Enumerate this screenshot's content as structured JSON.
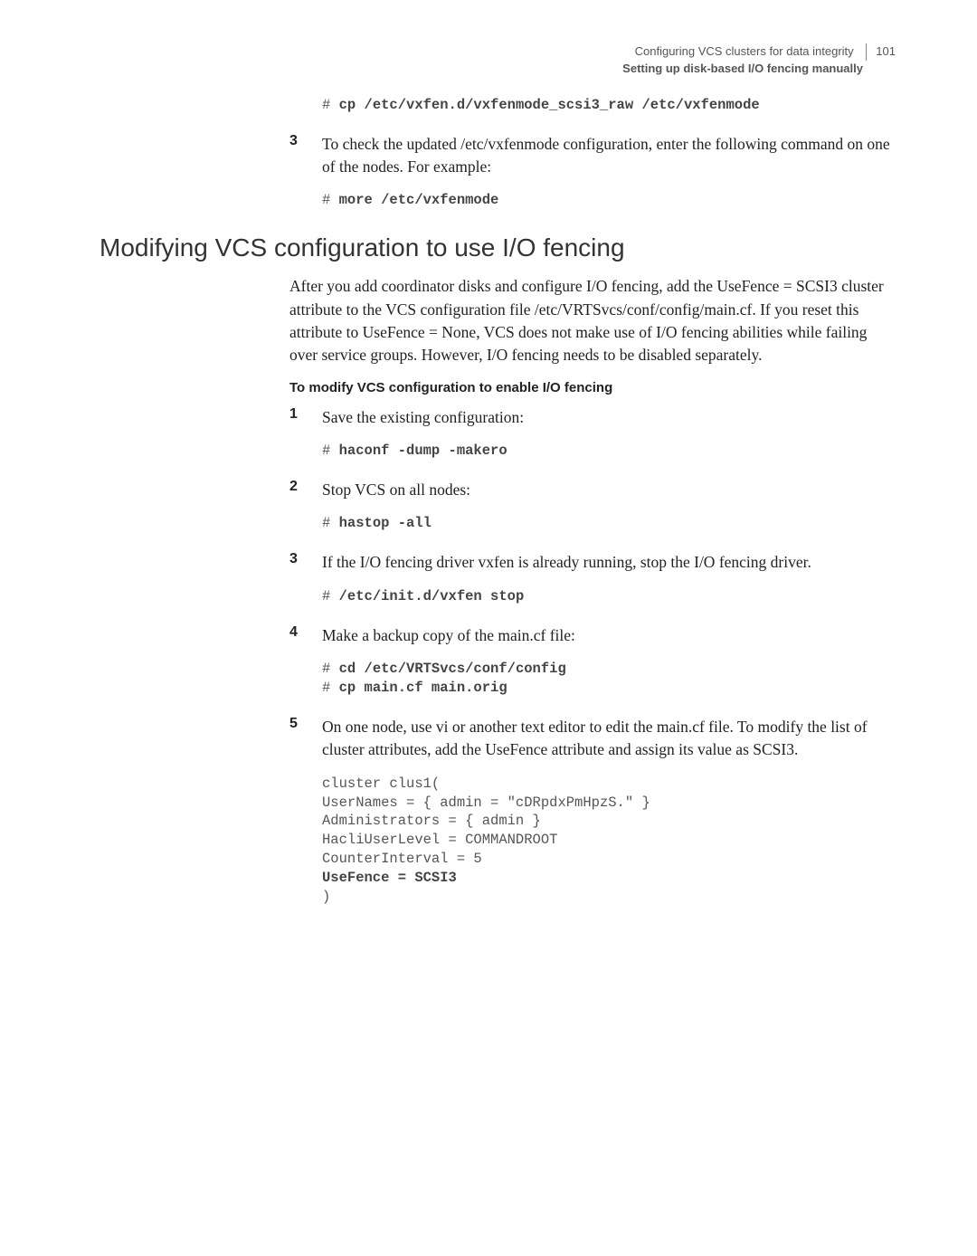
{
  "header": {
    "chapter": "Configuring VCS clusters for data integrity",
    "page": "101",
    "section": "Setting up disk-based I/O fencing manually"
  },
  "intro_code": "# cp /etc/vxfen.d/vxfenmode_scsi3_raw /etc/vxfenmode",
  "intro_step": {
    "num": "3",
    "text": "To check the updated /etc/vxfenmode configuration, enter the following command on one of the nodes. For example:"
  },
  "intro_step_code": "# more /etc/vxfenmode",
  "heading": "Modifying VCS configuration to use I/O fencing",
  "body": "After you add coordinator disks and configure I/O fencing, add the UseFence = SCSI3 cluster attribute to the VCS configuration file /etc/VRTSvcs/conf/config/main.cf. If you reset this attribute to UseFence = None, VCS does not make use of I/O fencing abilities while failing over service groups. However, I/O fencing needs to be disabled separately.",
  "subhead": "To modify VCS configuration to enable I/O fencing",
  "steps": [
    {
      "num": "1",
      "text": "Save the existing configuration:"
    },
    {
      "num": "2",
      "text": "Stop VCS on all nodes:"
    },
    {
      "num": "3",
      "text": "If the I/O fencing driver vxfen is already running, stop the I/O fencing driver."
    },
    {
      "num": "4",
      "text": "Make a backup copy of the main.cf file:"
    },
    {
      "num": "5",
      "text": "On one node, use vi or another text editor to edit the main.cf file. To modify the list of cluster attributes, add the UseFence attribute and assign its value as SCSI3."
    }
  ],
  "code1": "# haconf -dump -makero",
  "code2": "# hastop -all",
  "code3": "# /etc/init.d/vxfen stop",
  "code4": "# cd /etc/VRTSvcs/conf/config\n# cp main.cf main.orig",
  "code5_lines": [
    "cluster clus1(",
    "UserNames = { admin = \"cDRpdxPmHpzS.\" }",
    "Administrators = { admin }",
    "HacliUserLevel = COMMANDROOT",
    "CounterInterval = 5"
  ],
  "code5_bold": "UseFence = SCSI3",
  "code5_close": ")"
}
